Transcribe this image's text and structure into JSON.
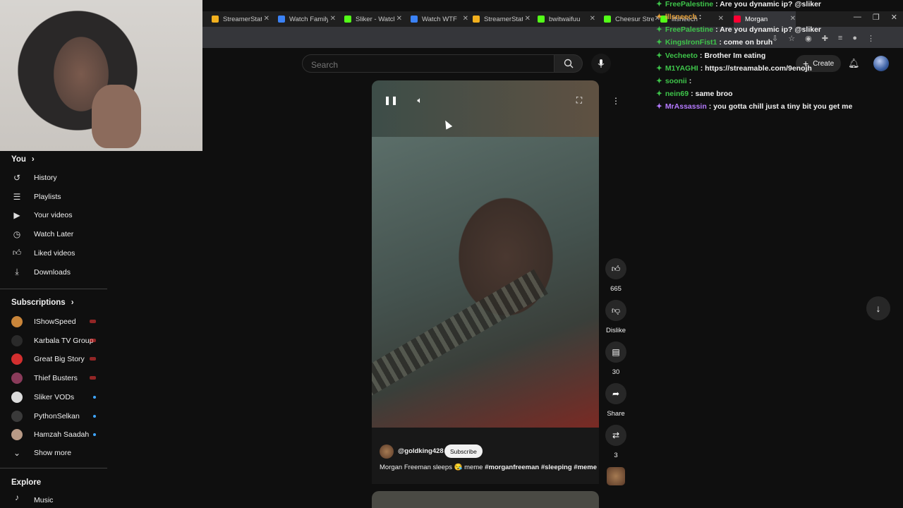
{
  "browser": {
    "tabs": [
      {
        "label": "StreamerStats",
        "favicon": "bar-chart-icon",
        "color": "#f2b01e",
        "active": false
      },
      {
        "label": "Watch Family Guy",
        "favicon": "globe-icon",
        "color": "#3b82f6",
        "active": false
      },
      {
        "label": "Sliker - Watch",
        "favicon": "kick-icon",
        "color": "#53fc18",
        "active": false
      },
      {
        "label": "Watch WTF",
        "favicon": "globe-icon",
        "color": "#3b82f6",
        "active": false
      },
      {
        "label": "StreamerStats",
        "favicon": "bar-chart-icon",
        "color": "#f2b01e",
        "active": false
      },
      {
        "label": "bwitwaifuu",
        "favicon": "kick-icon",
        "color": "#53fc18",
        "active": false
      },
      {
        "label": "Cheesur Stre",
        "favicon": "kick-icon",
        "color": "#53fc18",
        "active": false
      },
      {
        "label": "lllsneech",
        "favicon": "kick-icon",
        "color": "#53fc18",
        "active": false
      },
      {
        "label": "Morgan",
        "favicon": "youtube-icon",
        "color": "#ff0033",
        "active": true
      }
    ]
  },
  "header": {
    "search_placeholder": "Search",
    "create_label": "Create"
  },
  "sidebar": {
    "you_title": "You",
    "you_items": [
      {
        "label": "History",
        "icon": "history-icon"
      },
      {
        "label": "Playlists",
        "icon": "playlists-icon"
      },
      {
        "label": "Your videos",
        "icon": "your-videos-icon"
      },
      {
        "label": "Watch Later",
        "icon": "watch-later-icon"
      },
      {
        "label": "Liked videos",
        "icon": "liked-icon"
      },
      {
        "label": "Downloads",
        "icon": "download-icon"
      }
    ],
    "subs_title": "Subscriptions",
    "subs": [
      {
        "label": "IShowSpeed",
        "avatar_color": "#c9853a",
        "indicator": "live",
        "indicator_color": "#ff3b3b"
      },
      {
        "label": "Karbala TV Group",
        "avatar_color": "#2a2a2a",
        "indicator": "live",
        "indicator_color": "#ff3b3b"
      },
      {
        "label": "Great Big Story",
        "avatar_color": "#d32f2f",
        "indicator": "live",
        "indicator_color": "#ff3b3b"
      },
      {
        "label": "Thief Busters",
        "avatar_color": "#8a3b5a",
        "indicator": "live",
        "indicator_color": "#ff3b3b"
      },
      {
        "label": "Sliker VODs",
        "avatar_color": "#dcdcdc",
        "indicator": "dot",
        "indicator_color": "#3ea6ff"
      },
      {
        "label": "PythonSelkan",
        "avatar_color": "#3a3a3a",
        "indicator": "dot",
        "indicator_color": "#3ea6ff"
      },
      {
        "label": "Hamzah Saadah",
        "avatar_color": "#b89a86",
        "indicator": "dot",
        "indicator_color": "#3ea6ff"
      }
    ],
    "show_more": "Show more",
    "explore_title": "Explore",
    "explore_partial": "Music"
  },
  "short": {
    "channel": "@goldking428",
    "subscribe": "Subscribe",
    "caption_text": "Morgan Freeman sleeps 😪 meme",
    "caption_tags": "#morganfreeman #sleeping #meme",
    "likes": "665",
    "dislike": "Dislike",
    "comments": "30",
    "share": "Share",
    "remix": "3"
  },
  "chat": [
    {
      "user": "FreePalestine",
      "color": "#3ec44a",
      "msg": ": Are you dynamic ip? @sliker"
    },
    {
      "user": "lllsneech",
      "color": "#e8a33d",
      "msg": ":"
    },
    {
      "user": "FreePalestine",
      "color": "#3ec44a",
      "msg": ": Are you dynamic ip? @sliker"
    },
    {
      "user": "KingsIronFist1",
      "color": "#3ec44a",
      "msg": ": come on bruh"
    },
    {
      "user": "Vecheeto",
      "color": "#3ec44a",
      "msg": ": Brother Im eating"
    },
    {
      "user": "M1YAGHI",
      "color": "#3ec44a",
      "msg": ": https://streamable.com/9enojh"
    },
    {
      "user": "soonii",
      "color": "#3ec44a",
      "msg": ":"
    },
    {
      "user": "nein69",
      "color": "#3ec44a",
      "msg": ": same broo"
    },
    {
      "user": "MrAssassin",
      "color": "#b57aff",
      "msg": ": you gotta chill just a tiny bit you get me"
    }
  ]
}
